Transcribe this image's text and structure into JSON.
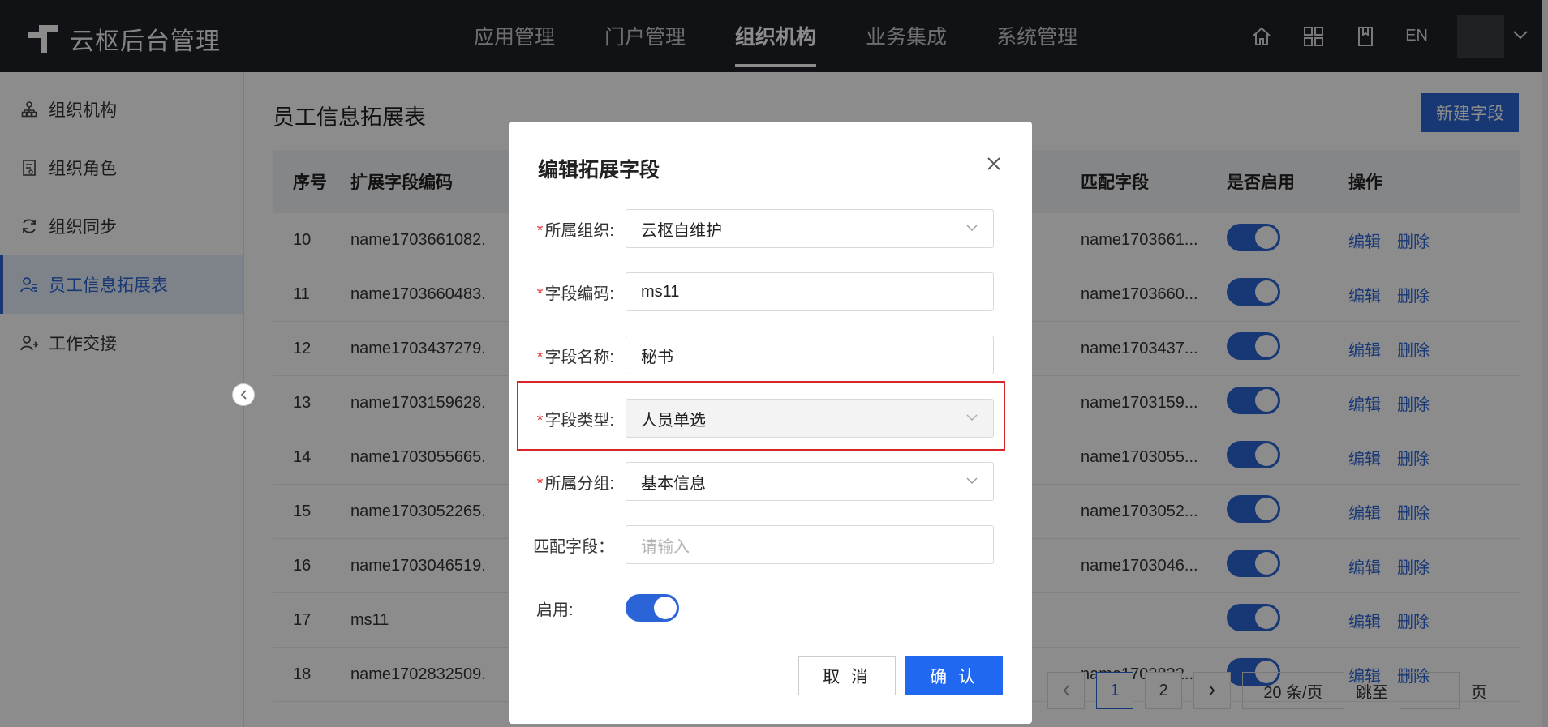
{
  "app": {
    "brand": "云枢后台管理"
  },
  "topnav": [
    {
      "label": "应用管理",
      "active": false
    },
    {
      "label": "门户管理",
      "active": false
    },
    {
      "label": "组织机构",
      "active": true
    },
    {
      "label": "业务集成",
      "active": false
    },
    {
      "label": "系统管理",
      "active": false
    }
  ],
  "header": {
    "lang": "EN",
    "icons": [
      "home-icon",
      "grid-icon",
      "book-icon"
    ]
  },
  "sidebar": {
    "items": [
      {
        "label": "组织机构",
        "icon": "org-tree-icon",
        "active": false
      },
      {
        "label": "组织角色",
        "icon": "role-doc-icon",
        "active": false
      },
      {
        "label": "组织同步",
        "icon": "sync-icon",
        "active": false
      },
      {
        "label": "员工信息拓展表",
        "icon": "user-list-icon",
        "active": true
      },
      {
        "label": "工作交接",
        "icon": "user-handover-icon",
        "active": false
      }
    ]
  },
  "main": {
    "title": "员工信息拓展表",
    "new_button": "新建字段",
    "columns": [
      "序号",
      "扩展字段编码",
      "",
      "匹配字段",
      "是否启用",
      "操作"
    ],
    "rows": [
      {
        "no": "10",
        "code": "name1703661082.",
        "match": "name1703661...",
        "enabled": true
      },
      {
        "no": "11",
        "code": "name1703660483.",
        "match": "name1703660...",
        "enabled": true
      },
      {
        "no": "12",
        "code": "name1703437279.",
        "match": "name1703437...",
        "enabled": true
      },
      {
        "no": "13",
        "code": "name1703159628.",
        "match": "name1703159...",
        "enabled": true
      },
      {
        "no": "14",
        "code": "name1703055665.",
        "match": "name1703055...",
        "enabled": true
      },
      {
        "no": "15",
        "code": "name1703052265.",
        "match": "name1703052...",
        "enabled": true
      },
      {
        "no": "16",
        "code": "name1703046519.",
        "match": "name1703046...",
        "enabled": true
      },
      {
        "no": "17",
        "code": "ms11",
        "match": "",
        "enabled": true
      },
      {
        "no": "18",
        "code": "name1702832509.",
        "match": "name1702832...",
        "enabled": true
      }
    ],
    "edit_label": "编辑",
    "delete_label": "删除",
    "pager": {
      "pages": [
        "1",
        "2"
      ],
      "current": "1",
      "page_size": "20 条/页",
      "jump_label": "跳至",
      "page_unit": "页"
    }
  },
  "modal": {
    "title": "编辑拓展字段",
    "fields": [
      {
        "label": "所属组织:",
        "required": true,
        "value": "云枢自维护",
        "type": "select"
      },
      {
        "label": "字段编码:",
        "required": true,
        "value": "ms11",
        "type": "input"
      },
      {
        "label": "字段名称:",
        "required": true,
        "value": "秘书",
        "type": "input"
      },
      {
        "label": "字段类型:",
        "required": true,
        "value": "人员单选",
        "type": "select-disabled"
      },
      {
        "label": "所属分组:",
        "required": true,
        "value": "基本信息",
        "type": "select"
      },
      {
        "label": "匹配字段：",
        "required": false,
        "placeholder": "请输入",
        "type": "input"
      }
    ],
    "enable_label": "启用:",
    "enabled": true,
    "cancel_label": "取 消",
    "ok_label": "确 认"
  }
}
